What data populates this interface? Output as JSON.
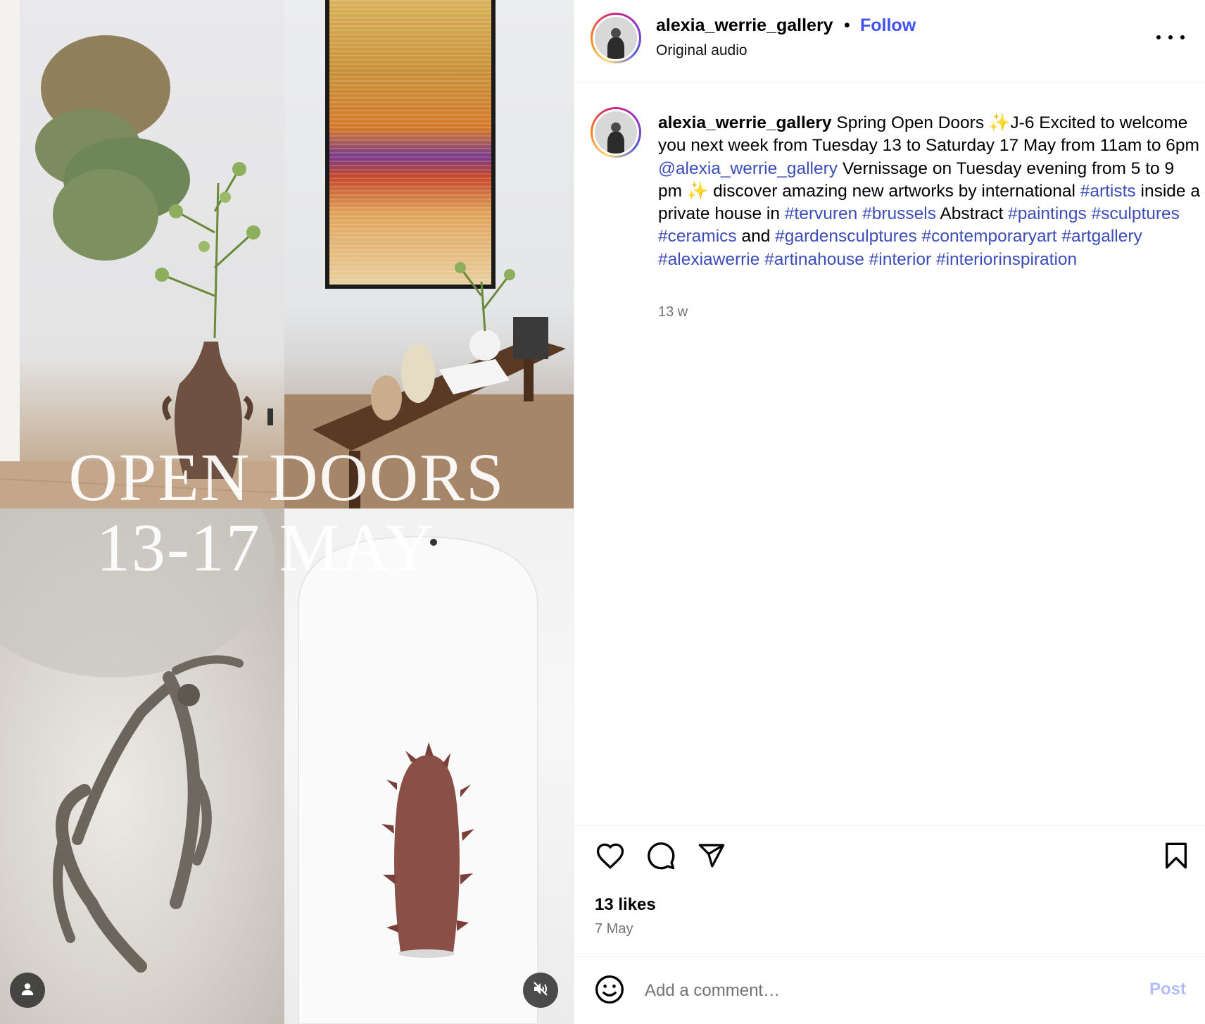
{
  "media": {
    "overlay_line1": "OPEN DOORS",
    "overlay_line2": "13-17 MAY",
    "user_button_icon": "person-icon",
    "mute_button_icon": "speaker-muted-icon"
  },
  "header": {
    "username": "alexia_werrie_gallery",
    "separator": "•",
    "follow_label": "Follow",
    "audio": "Original audio",
    "more_icon": "more-horizontal-icon"
  },
  "caption": {
    "username": "alexia_werrie_gallery",
    "segments": [
      {
        "text": " Spring Open Doors ",
        "type": "text"
      },
      {
        "text": "✨",
        "type": "emoji"
      },
      {
        "text": "J-6 Excited to welcome you next week from Tuesday 13 to Saturday 17 May from 11am to 6pm ",
        "type": "text"
      },
      {
        "text": "@alexia_werrie_gallery",
        "type": "tag"
      },
      {
        "text": " Vernissage on Tuesday evening from 5 to 9 pm ",
        "type": "text"
      },
      {
        "text": "✨",
        "type": "emoji"
      },
      {
        "text": " discover amazing new artworks by international ",
        "type": "text"
      },
      {
        "text": "#artists",
        "type": "tag"
      },
      {
        "text": " inside a private house in ",
        "type": "text"
      },
      {
        "text": "#tervuren",
        "type": "tag"
      },
      {
        "text": " ",
        "type": "text"
      },
      {
        "text": "#brussels",
        "type": "tag"
      },
      {
        "text": " Abstract ",
        "type": "text"
      },
      {
        "text": "#paintings",
        "type": "tag"
      },
      {
        "text": " ",
        "type": "text"
      },
      {
        "text": "#sculptures",
        "type": "tag"
      },
      {
        "text": " ",
        "type": "text"
      },
      {
        "text": "#ceramics",
        "type": "tag"
      },
      {
        "text": " and ",
        "type": "text"
      },
      {
        "text": "#gardensculptures",
        "type": "tag"
      },
      {
        "text": " ",
        "type": "text"
      },
      {
        "text": "#contemporaryart",
        "type": "tag"
      },
      {
        "text": " ",
        "type": "text"
      },
      {
        "text": "#artgallery",
        "type": "tag"
      },
      {
        "text": " ",
        "type": "text"
      },
      {
        "text": "#alexiawerrie",
        "type": "tag"
      },
      {
        "text": " ",
        "type": "text"
      },
      {
        "text": "#artinahouse",
        "type": "tag"
      },
      {
        "text": " ",
        "type": "text"
      },
      {
        "text": "#interior",
        "type": "tag"
      },
      {
        "text": " ",
        "type": "text"
      },
      {
        "text": "#interiorinspiration",
        "type": "tag"
      }
    ],
    "time": "13 w"
  },
  "actions": {
    "like_icon": "heart-icon",
    "comment_icon": "comment-bubble-icon",
    "share_icon": "paper-plane-icon",
    "save_icon": "bookmark-icon",
    "likes": "13 likes",
    "date": "7 May"
  },
  "comment_bar": {
    "emoji_icon": "smiley-icon",
    "placeholder": "Add a comment…",
    "post_label": "Post"
  },
  "colors": {
    "accent": "#4150f7",
    "tag": "#3d4db8",
    "muted": "#737373",
    "post_disabled": "#b3bdf8"
  }
}
